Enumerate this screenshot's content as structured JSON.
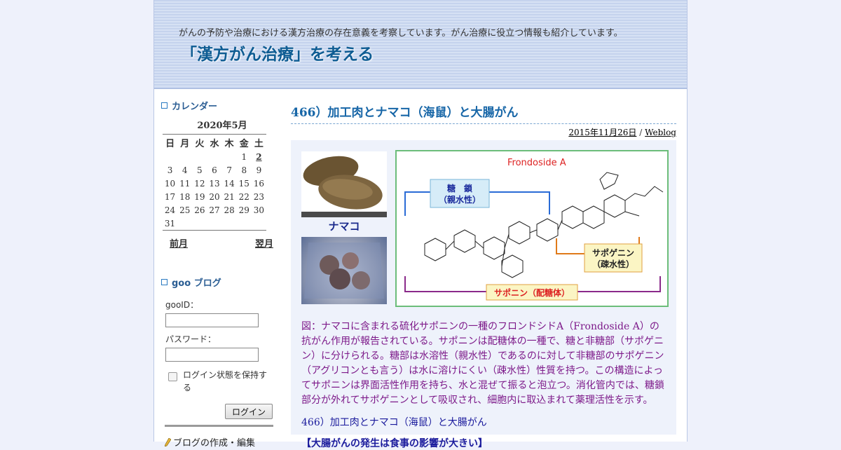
{
  "header": {
    "tagline": "がんの予防や治療における漢方治療の存在意義を考察しています。がん治療に役立つ情報も紹介しています。",
    "site_title": "「漢方がん治療」を考える"
  },
  "sidebar": {
    "calendar_heading": "カレンダー",
    "calendar_title": "2020年5月",
    "weekdays": [
      "日",
      "月",
      "火",
      "水",
      "木",
      "金",
      "土"
    ],
    "weeks": [
      [
        "",
        "",
        "",
        "",
        "",
        "1",
        "2"
      ],
      [
        "3",
        "4",
        "5",
        "6",
        "7",
        "8",
        "9"
      ],
      [
        "10",
        "11",
        "12",
        "13",
        "14",
        "15",
        "16"
      ],
      [
        "17",
        "18",
        "19",
        "20",
        "21",
        "22",
        "23"
      ],
      [
        "24",
        "25",
        "26",
        "27",
        "28",
        "29",
        "30"
      ],
      [
        "31",
        "",
        "",
        "",
        "",
        "",
        ""
      ]
    ],
    "linked_day": "2",
    "prev_month": "前月",
    "next_month": "翌月",
    "goo_heading": "goo ブログ",
    "login": {
      "id_label": "gooID：",
      "password_label": "パスワード：",
      "remember_label": "ログイン状態を保持する",
      "button_label": "ログイン"
    },
    "blog_create": "ブログの作成・編集"
  },
  "entry": {
    "title": "466）加工肉とナマコ（海鼠）と大腸がん",
    "date": "2015年11月26日",
    "separator": "/",
    "category": "Weblog",
    "figure": {
      "photo_label": "ナマコ",
      "compound_name": "Frondoside A",
      "sugar_label_1": "糖　鎖",
      "sugar_label_2": "（親水性）",
      "sapogenin_label_1": "サポゲニン",
      "sapogenin_label_2": "（疎水性）",
      "saponin_label": "サポニン（配糖体）"
    },
    "caption": "図：ナマコに含まれる硫化サポニンの一種のフロンドシドA（Frondoside A）の抗がん作用が報告されている。サポニンは配糖体の一種で、糖と非糖部（サポゲニン）に分けられる。糖部は水溶性（親水性）であるのに対して非糖部のサポゲニン（アグリコンとも言う）は水に溶けにくい（疎水性）性質を持つ。この構造によってサポニンは界面活性作用を持ち、水と混ぜて振ると泡立つ。消化管内では、糖鎖部分が外れてサポゲニンとして吸収され、細胞内に取込まれて薬理活性を示す。",
    "subtitle": "466）加工肉とナマコ（海鼠）と大腸がん",
    "section_heading": "【大腸がんの発生は食事の影響が大きい】"
  },
  "colors": {
    "title_blue": "#1766a7",
    "caption_purple": "#7d1a8a",
    "header_blue": "#c8d6ef"
  }
}
